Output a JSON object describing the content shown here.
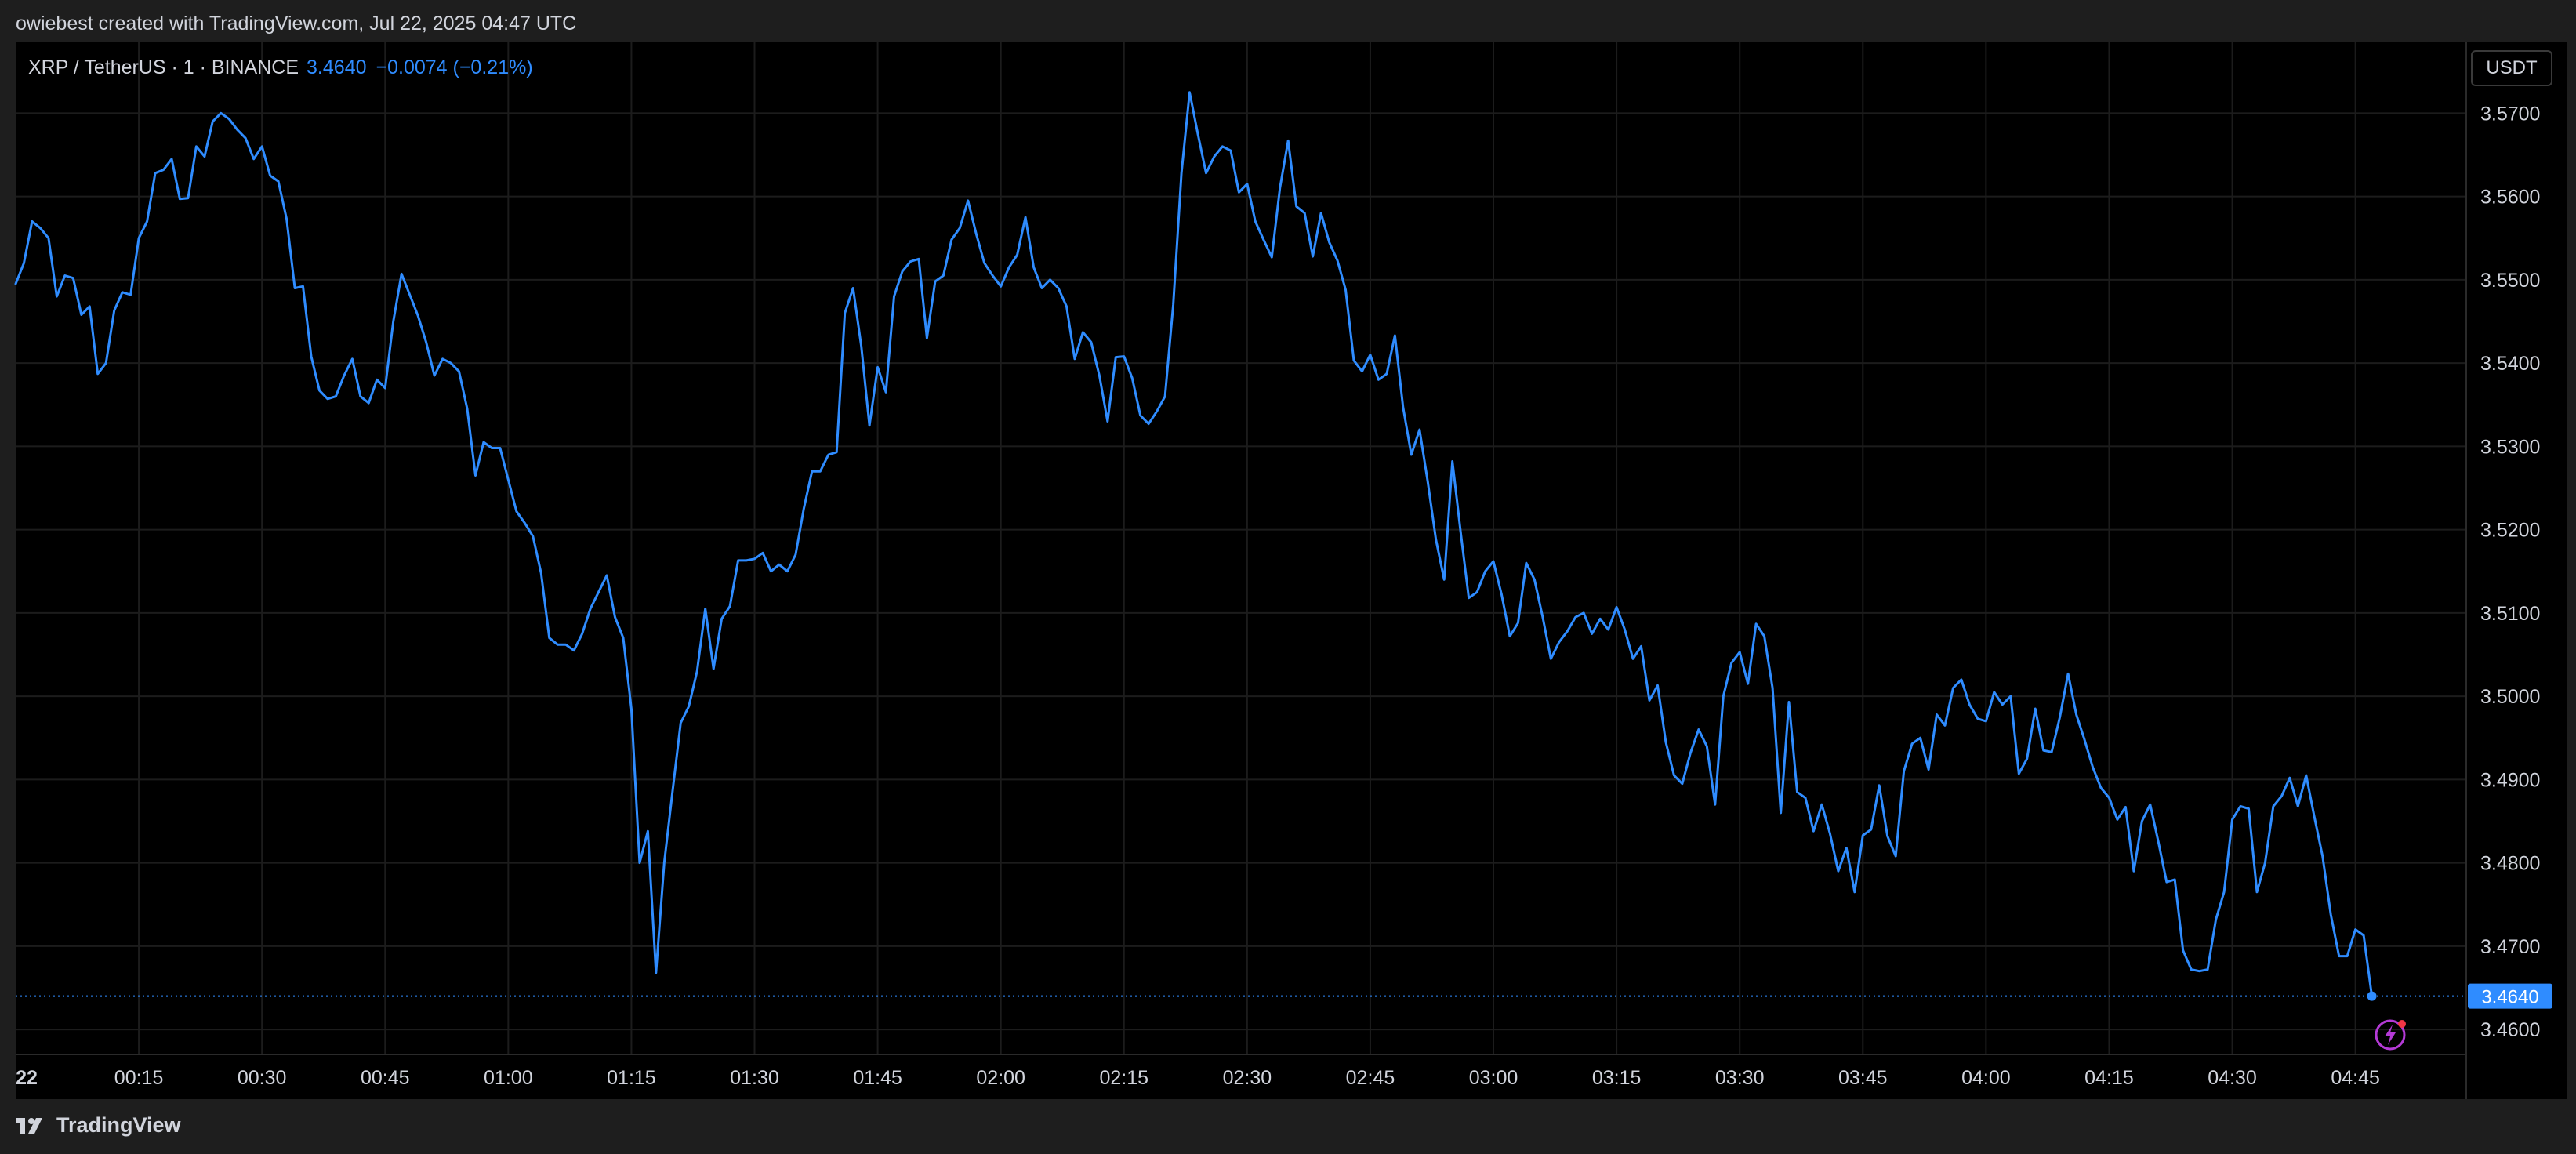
{
  "header": {
    "attribution": "owiebest created with TradingView.com, Jul 22, 2025 04:47 UTC"
  },
  "legend": {
    "symbol": "XRP / TetherUS · 1 · BINANCE",
    "price": "3.4640",
    "change": "−0.0074 (−0.21%)"
  },
  "currency_button": "USDT",
  "footer": {
    "brand": "TradingView",
    "logo_icon": "tradingview-logo-icon"
  },
  "colors": {
    "line": "#2f8cff",
    "background": "#000000",
    "grid": "#1c1c1c",
    "text": "#d1d4dc",
    "price_tag": "#2f8cff",
    "alert_icon": "#b43ad6"
  },
  "alert_icon": "lightning-alert-icon",
  "chart_data": {
    "type": "line",
    "title": "",
    "xlabel": "",
    "ylabel": "",
    "ylim": [
      3.457,
      3.5785
    ],
    "x_ticks": [
      {
        "label": "22",
        "x": 0
      },
      {
        "label": "00:15",
        "x": 15
      },
      {
        "label": "00:30",
        "x": 30
      },
      {
        "label": "00:45",
        "x": 45
      },
      {
        "label": "01:00",
        "x": 60
      },
      {
        "label": "01:15",
        "x": 75
      },
      {
        "label": "01:30",
        "x": 90
      },
      {
        "label": "01:45",
        "x": 105
      },
      {
        "label": "02:00",
        "x": 120
      },
      {
        "label": "02:15",
        "x": 135
      },
      {
        "label": "02:30",
        "x": 150
      },
      {
        "label": "02:45",
        "x": 165
      },
      {
        "label": "03:00",
        "x": 180
      },
      {
        "label": "03:15",
        "x": 195
      },
      {
        "label": "03:30",
        "x": 210
      },
      {
        "label": "03:45",
        "x": 225
      },
      {
        "label": "04:00",
        "x": 240
      },
      {
        "label": "04:15",
        "x": 255
      },
      {
        "label": "04:30",
        "x": 270
      },
      {
        "label": "04:45",
        "x": 285
      }
    ],
    "x_max": 298.5,
    "y_ticks": [
      "3.5700",
      "3.5600",
      "3.5500",
      "3.5400",
      "3.5300",
      "3.5200",
      "3.5100",
      "3.5000",
      "3.4900",
      "3.4800",
      "3.4700",
      "3.4600"
    ],
    "last_price": 3.464,
    "last_price_label": "3.4640",
    "grid": true,
    "series": [
      {
        "points": [
          [
            0,
            3.5495
          ],
          [
            1,
            3.552
          ],
          [
            2,
            3.557
          ],
          [
            3,
            3.5562
          ],
          [
            4,
            3.555
          ],
          [
            5,
            3.548
          ],
          [
            6,
            3.5505
          ],
          [
            7,
            3.5502
          ],
          [
            8,
            3.5458
          ],
          [
            9,
            3.5468
          ],
          [
            10,
            3.5387
          ],
          [
            11,
            3.54
          ],
          [
            12,
            3.5463
          ],
          [
            13,
            3.5485
          ],
          [
            14,
            3.5482
          ],
          [
            15,
            3.555
          ],
          [
            16,
            3.557
          ],
          [
            17,
            3.5628
          ],
          [
            18,
            3.5632
          ],
          [
            19,
            3.5645
          ],
          [
            20,
            3.5597
          ],
          [
            21,
            3.5598
          ],
          [
            22,
            3.566
          ],
          [
            23,
            3.5648
          ],
          [
            24,
            3.569
          ],
          [
            25,
            3.57
          ],
          [
            26,
            3.5693
          ],
          [
            27,
            3.568
          ],
          [
            28,
            3.567
          ],
          [
            29,
            3.5645
          ],
          [
            30,
            3.566
          ],
          [
            31,
            3.5625
          ],
          [
            32,
            3.5618
          ],
          [
            33,
            3.5573
          ],
          [
            34,
            3.549
          ],
          [
            35,
            3.5492
          ],
          [
            36,
            3.5408
          ],
          [
            37,
            3.5367
          ],
          [
            38,
            3.5357
          ],
          [
            39,
            3.536
          ],
          [
            40,
            3.5385
          ],
          [
            41,
            3.5405
          ],
          [
            42,
            3.536
          ],
          [
            43,
            3.5352
          ],
          [
            44,
            3.538
          ],
          [
            45,
            3.537
          ],
          [
            46,
            3.545
          ],
          [
            47,
            3.5507
          ],
          [
            48,
            3.5482
          ],
          [
            49,
            3.5457
          ],
          [
            50,
            3.5425
          ],
          [
            51,
            3.5385
          ],
          [
            52,
            3.5405
          ],
          [
            53,
            3.54
          ],
          [
            54,
            3.539
          ],
          [
            55,
            3.5345
          ],
          [
            56,
            3.5265
          ],
          [
            57,
            3.5305
          ],
          [
            58,
            3.5298
          ],
          [
            59,
            3.5298
          ],
          [
            60,
            3.526
          ],
          [
            61,
            3.5222
          ],
          [
            62,
            3.5208
          ],
          [
            63,
            3.5192
          ],
          [
            64,
            3.5148
          ],
          [
            65,
            3.507
          ],
          [
            66,
            3.5062
          ],
          [
            67,
            3.5062
          ],
          [
            68,
            3.5055
          ],
          [
            69,
            3.5075
          ],
          [
            70,
            3.5105
          ],
          [
            71,
            3.5125
          ],
          [
            72,
            3.5145
          ],
          [
            73,
            3.5095
          ],
          [
            74,
            3.507
          ],
          [
            75,
            3.4985
          ],
          [
            76,
            3.48
          ],
          [
            77,
            3.4838
          ],
          [
            78,
            3.4668
          ],
          [
            79,
            3.48
          ],
          [
            80,
            3.4885
          ],
          [
            81,
            3.4968
          ],
          [
            82,
            3.4988
          ],
          [
            83,
            3.503
          ],
          [
            84,
            3.5105
          ],
          [
            85,
            3.5033
          ],
          [
            86,
            3.5093
          ],
          [
            87,
            3.5108
          ],
          [
            88,
            3.5163
          ],
          [
            89,
            3.5163
          ],
          [
            90,
            3.5165
          ],
          [
            91,
            3.5172
          ],
          [
            92,
            3.515
          ],
          [
            93,
            3.5158
          ],
          [
            94,
            3.515
          ],
          [
            95,
            3.517
          ],
          [
            96,
            3.5225
          ],
          [
            97,
            3.527
          ],
          [
            98,
            3.527
          ],
          [
            99,
            3.529
          ],
          [
            100,
            3.5293
          ],
          [
            101,
            3.546
          ],
          [
            102,
            3.549
          ],
          [
            103,
            3.542
          ],
          [
            104,
            3.5325
          ],
          [
            105,
            3.5395
          ],
          [
            106,
            3.5365
          ],
          [
            107,
            3.548
          ],
          [
            108,
            3.551
          ],
          [
            109,
            3.5522
          ],
          [
            110,
            3.5525
          ],
          [
            111,
            3.543
          ],
          [
            112,
            3.5498
          ],
          [
            113,
            3.5505
          ],
          [
            114,
            3.5548
          ],
          [
            115,
            3.5562
          ],
          [
            116,
            3.5595
          ],
          [
            117,
            3.5555
          ],
          [
            118,
            3.552
          ],
          [
            119,
            3.5505
          ],
          [
            120,
            3.5492
          ],
          [
            121,
            3.5515
          ],
          [
            122,
            3.553
          ],
          [
            123,
            3.5575
          ],
          [
            124,
            3.5515
          ],
          [
            125,
            3.549
          ],
          [
            126,
            3.55
          ],
          [
            127,
            3.549
          ],
          [
            128,
            3.5468
          ],
          [
            129,
            3.5405
          ],
          [
            130,
            3.5437
          ],
          [
            131,
            3.5425
          ],
          [
            132,
            3.5385
          ],
          [
            133,
            3.533
          ],
          [
            134,
            3.5407
          ],
          [
            135,
            3.5408
          ],
          [
            136,
            3.5382
          ],
          [
            137,
            3.5337
          ],
          [
            138,
            3.5327
          ],
          [
            139,
            3.5342
          ],
          [
            140,
            3.536
          ],
          [
            141,
            3.547
          ],
          [
            142,
            3.5628
          ],
          [
            143,
            3.5725
          ],
          [
            144,
            3.5675
          ],
          [
            145,
            3.5628
          ],
          [
            146,
            3.5648
          ],
          [
            147,
            3.566
          ],
          [
            148,
            3.5655
          ],
          [
            149,
            3.5605
          ],
          [
            150,
            3.5615
          ],
          [
            151,
            3.557
          ],
          [
            152,
            3.5548
          ],
          [
            153,
            3.5527
          ],
          [
            154,
            3.561
          ],
          [
            155,
            3.5667
          ],
          [
            156,
            3.5588
          ],
          [
            157,
            3.558
          ],
          [
            158,
            3.5528
          ],
          [
            159,
            3.558
          ],
          [
            160,
            3.5545
          ],
          [
            161,
            3.5523
          ],
          [
            162,
            3.5488
          ],
          [
            163,
            3.5403
          ],
          [
            164,
            3.539
          ],
          [
            165,
            3.541
          ],
          [
            166,
            3.538
          ],
          [
            167,
            3.5387
          ],
          [
            168,
            3.5433
          ],
          [
            169,
            3.5347
          ],
          [
            170,
            3.529
          ],
          [
            171,
            3.532
          ],
          [
            172,
            3.5258
          ],
          [
            173,
            3.5188
          ],
          [
            174,
            3.514
          ],
          [
            175,
            3.5282
          ],
          [
            176,
            3.5198
          ],
          [
            177,
            3.5118
          ],
          [
            178,
            3.5125
          ],
          [
            179,
            3.515
          ],
          [
            180,
            3.5162
          ],
          [
            181,
            3.5122
          ],
          [
            182,
            3.5072
          ],
          [
            183,
            3.5088
          ],
          [
            184,
            3.516
          ],
          [
            185,
            3.514
          ],
          [
            186,
            3.5095
          ],
          [
            187,
            3.5045
          ],
          [
            188,
            3.5065
          ],
          [
            189,
            3.5078
          ],
          [
            190,
            3.5095
          ],
          [
            191,
            3.51
          ],
          [
            192,
            3.5075
          ],
          [
            193,
            3.5093
          ],
          [
            194,
            3.508
          ],
          [
            195,
            3.5107
          ],
          [
            196,
            3.508
          ],
          [
            197,
            3.5045
          ],
          [
            198,
            3.506
          ],
          [
            199,
            3.4995
          ],
          [
            200,
            3.5013
          ],
          [
            201,
            3.4945
          ],
          [
            202,
            3.4905
          ],
          [
            203,
            3.4895
          ],
          [
            204,
            3.4932
          ],
          [
            205,
            3.496
          ],
          [
            206,
            3.494
          ],
          [
            207,
            3.487
          ],
          [
            208,
            3.5
          ],
          [
            209,
            3.504
          ],
          [
            210,
            3.5053
          ],
          [
            211,
            3.5015
          ],
          [
            212,
            3.5087
          ],
          [
            213,
            3.5072
          ],
          [
            214,
            3.501
          ],
          [
            215,
            3.486
          ],
          [
            216,
            3.4993
          ],
          [
            217,
            3.4885
          ],
          [
            218,
            3.4878
          ],
          [
            219,
            3.4838
          ],
          [
            220,
            3.487
          ],
          [
            221,
            3.4835
          ],
          [
            222,
            3.479
          ],
          [
            223,
            3.4818
          ],
          [
            224,
            3.4765
          ],
          [
            225,
            3.4833
          ],
          [
            226,
            3.484
          ],
          [
            227,
            3.4893
          ],
          [
            228,
            3.4832
          ],
          [
            229,
            3.4808
          ],
          [
            230,
            3.491
          ],
          [
            231,
            3.4943
          ],
          [
            232,
            3.495
          ],
          [
            233,
            3.4912
          ],
          [
            234,
            3.4978
          ],
          [
            235,
            3.4965
          ],
          [
            236,
            3.501
          ],
          [
            237,
            3.502
          ],
          [
            238,
            3.499
          ],
          [
            239,
            3.4973
          ],
          [
            240,
            3.497
          ],
          [
            241,
            3.5005
          ],
          [
            242,
            3.499
          ],
          [
            243,
            3.5
          ],
          [
            244,
            3.4907
          ],
          [
            245,
            3.4925
          ],
          [
            246,
            3.4985
          ],
          [
            247,
            3.4935
          ],
          [
            248,
            3.4933
          ],
          [
            249,
            3.4975
          ],
          [
            250,
            3.5027
          ],
          [
            251,
            3.4978
          ],
          [
            252,
            3.4948
          ],
          [
            253,
            3.4915
          ],
          [
            254,
            3.489
          ],
          [
            255,
            3.4878
          ],
          [
            256,
            3.4852
          ],
          [
            257,
            3.4867
          ],
          [
            258,
            3.479
          ],
          [
            259,
            3.485
          ],
          [
            260,
            3.487
          ],
          [
            261,
            3.4825
          ],
          [
            262,
            3.4777
          ],
          [
            263,
            3.478
          ],
          [
            264,
            3.4695
          ],
          [
            265,
            3.4672
          ],
          [
            266,
            3.467
          ],
          [
            267,
            3.4672
          ],
          [
            268,
            3.4732
          ],
          [
            269,
            3.4765
          ],
          [
            270,
            3.4852
          ],
          [
            271,
            3.4868
          ],
          [
            272,
            3.4865
          ],
          [
            273,
            3.4765
          ],
          [
            274,
            3.48
          ],
          [
            275,
            3.4868
          ],
          [
            276,
            3.488
          ],
          [
            277,
            3.4902
          ],
          [
            278,
            3.4868
          ],
          [
            279,
            3.4905
          ],
          [
            280,
            3.4855
          ],
          [
            281,
            3.4808
          ],
          [
            282,
            3.4738
          ],
          [
            283,
            3.4688
          ],
          [
            284,
            3.4688
          ],
          [
            285,
            3.472
          ],
          [
            286,
            3.4713
          ],
          [
            287,
            3.464
          ]
        ]
      }
    ]
  }
}
